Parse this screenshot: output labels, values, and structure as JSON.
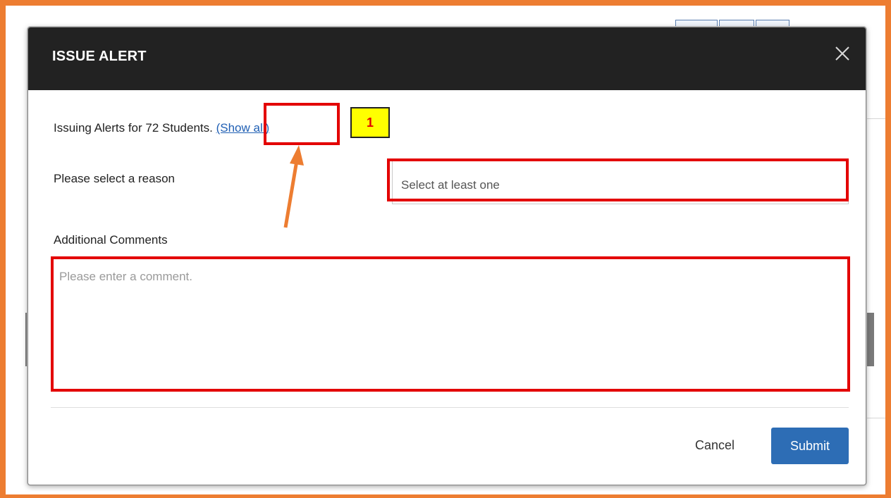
{
  "modal": {
    "title": "ISSUE ALERT",
    "students_text": "Issuing Alerts for 72 Students.",
    "show_all_label": "(Show all)",
    "reason_label": "Please select a reason",
    "reason_placeholder": "Select at least one",
    "comments_label": "Additional Comments",
    "comments_placeholder": "Please enter a comment.",
    "cancel_label": "Cancel",
    "submit_label": "Submit",
    "close_icon": "close-icon"
  },
  "annotation": {
    "step_number": "1",
    "highlight_color": "#e30000",
    "arrow_color": "#ed7d31",
    "badge_color": "#ffff00"
  },
  "colors": {
    "header_bg": "#222222",
    "link": "#1f5fb4",
    "primary_button": "#2d6db5",
    "frame": "#ed7d31"
  }
}
